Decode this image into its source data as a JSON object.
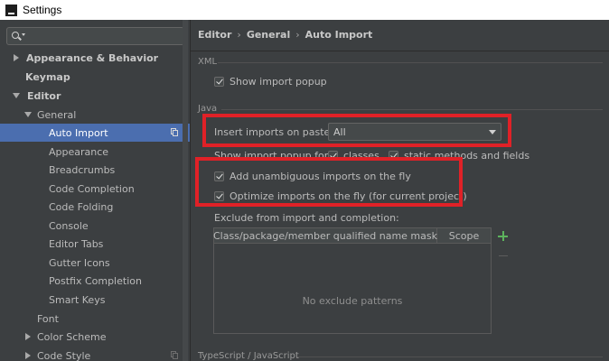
{
  "window": {
    "title": "Settings"
  },
  "sidebar": {
    "items": [
      {
        "label": "Appearance & Behavior",
        "bold": true
      },
      {
        "label": "Keymap",
        "bold": true
      },
      {
        "label": "Editor",
        "bold": true
      },
      {
        "label": "General"
      },
      {
        "label": "Auto Import",
        "selected": true
      },
      {
        "label": "Appearance"
      },
      {
        "label": "Breadcrumbs"
      },
      {
        "label": "Code Completion"
      },
      {
        "label": "Code Folding"
      },
      {
        "label": "Console"
      },
      {
        "label": "Editor Tabs"
      },
      {
        "label": "Gutter Icons"
      },
      {
        "label": "Postfix Completion"
      },
      {
        "label": "Smart Keys"
      },
      {
        "label": "Font"
      },
      {
        "label": "Color Scheme"
      },
      {
        "label": "Code Style"
      }
    ]
  },
  "breadcrumb": {
    "part1": "Editor",
    "part2": "General",
    "part3": "Auto Import",
    "separator": "›"
  },
  "xml": {
    "section_label": "XML",
    "show_import_popup": {
      "label": "Show import popup",
      "checked": true
    }
  },
  "java": {
    "section_label": "Java",
    "insert_imports_label": "Insert imports on paste:",
    "insert_imports_value": "All",
    "show_popup_for_label": "Show import popup for:",
    "classes": {
      "label": "classes",
      "checked": true
    },
    "static_methods": {
      "label": "static methods and fields",
      "checked": true
    },
    "add_unambiguous": {
      "label": "Add unambiguous imports on the fly",
      "checked": true
    },
    "optimize_imports": {
      "label": "Optimize imports on the fly (for current project)",
      "checked": true
    },
    "exclude_label": "Exclude from import and completion:",
    "table": {
      "columns": [
        "Class/package/member qualified name mask",
        "Scope"
      ],
      "empty_text": "No exclude patterns"
    }
  },
  "typescript": {
    "section_label": "TypeScript / JavaScript"
  },
  "colors": {
    "selection": "#4b6eaf",
    "highlight_box": "#e02127",
    "add_icon": "#5db35d"
  }
}
